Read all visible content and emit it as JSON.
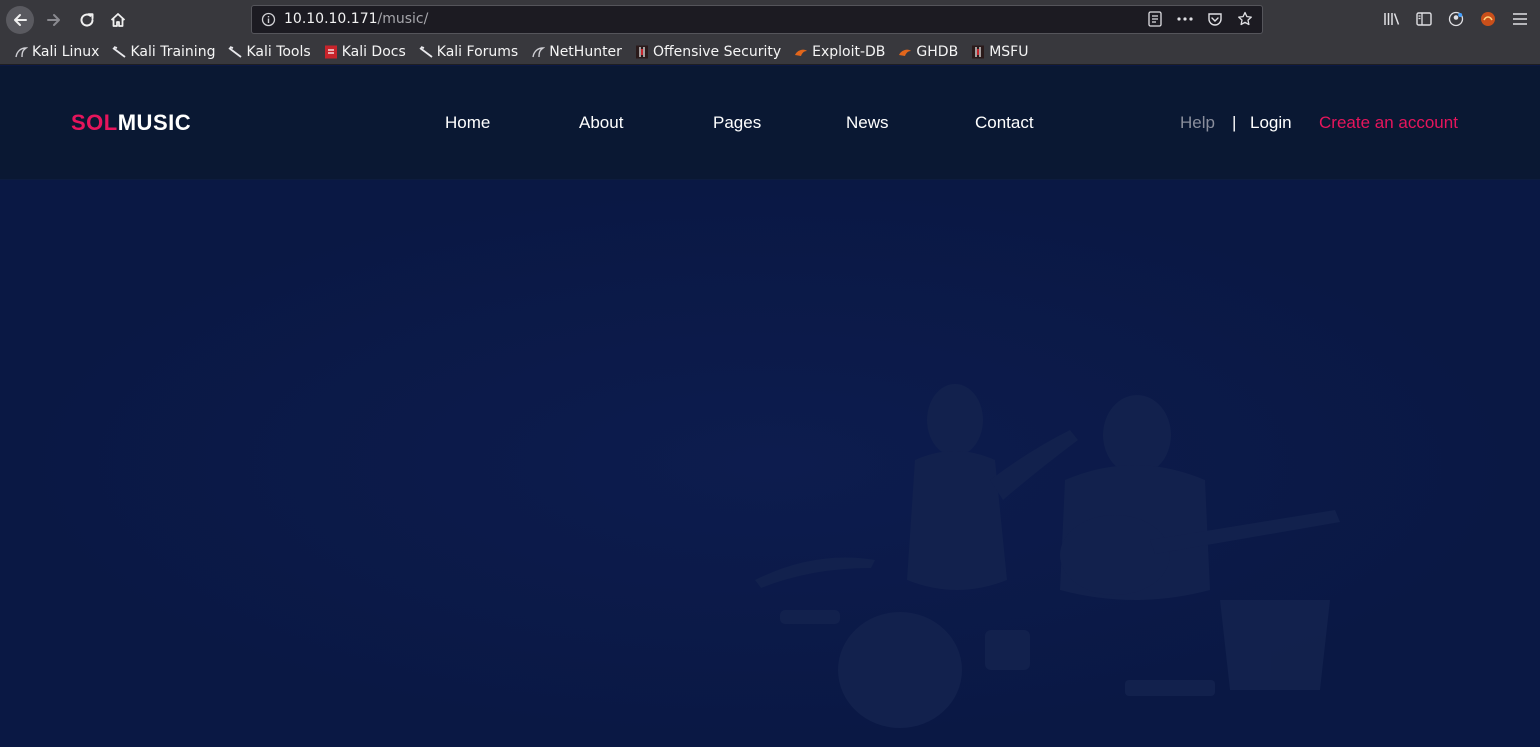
{
  "browser": {
    "url_host": "10.10.10.171",
    "url_path": "/music/",
    "bookmarks": [
      {
        "label": "Kali Linux",
        "icon": "kali-dragon-icon"
      },
      {
        "label": "Kali Training",
        "icon": "kali-knife-icon"
      },
      {
        "label": "Kali Tools",
        "icon": "kali-knife-icon"
      },
      {
        "label": "Kali Docs",
        "icon": "docs-icon"
      },
      {
        "label": "Kali Forums",
        "icon": "kali-knife-icon"
      },
      {
        "label": "NetHunter",
        "icon": "kali-dragon-icon"
      },
      {
        "label": "Offensive Security",
        "icon": "offsec-icon"
      },
      {
        "label": "Exploit-DB",
        "icon": "exploitdb-icon"
      },
      {
        "label": "GHDB",
        "icon": "exploitdb-icon"
      },
      {
        "label": "MSFU",
        "icon": "offsec-icon"
      }
    ],
    "colors": {
      "chrome": "#38383d",
      "urlbar": "#1c1b22"
    }
  },
  "site": {
    "logo_part1": "SOL",
    "logo_part2": "MUSIC",
    "nav": [
      "Home",
      "About",
      "Pages",
      "News",
      "Contact"
    ],
    "help": "Help",
    "separator": "|",
    "login": "Login",
    "create_account": "Create an account",
    "colors": {
      "accent": "#e6155c",
      "header_bg": "#0a1833",
      "hero_bg": "#0a1844"
    }
  }
}
